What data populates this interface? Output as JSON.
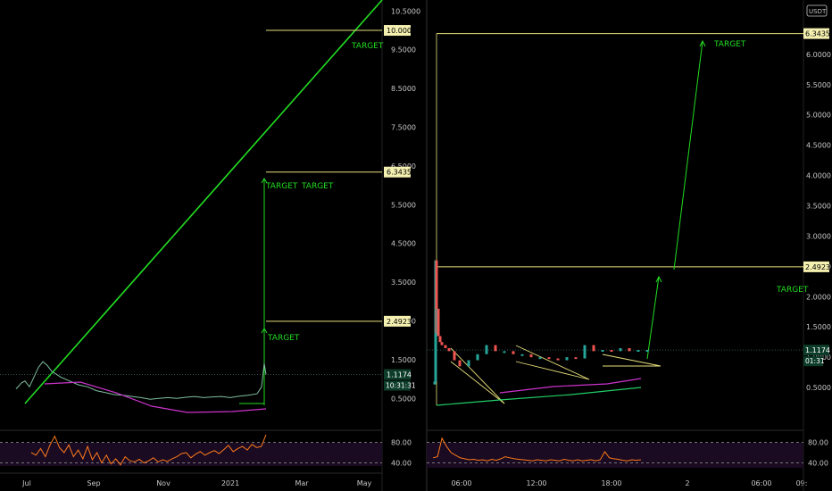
{
  "colors": {
    "background": "#000000",
    "axis_text": "#c8c8c8",
    "grid": "#1f1f1f",
    "target": "#22dd22",
    "level_line": "#e8e07a",
    "price_tag_bg": "#f4f0b0",
    "current_tag_bg": "#0d3d2a",
    "current_tag_text": "#ffffff",
    "up_candle": "#26a69a",
    "down_candle": "#ef5350",
    "ma_magenta": "#cc33cc",
    "ma_green": "#22cc66",
    "rsi_line": "#ff7a1a",
    "rsi_band": "#1a0a22"
  },
  "chart_data": [
    {
      "type": "line",
      "panel": "left-daily",
      "x_tick_labels": [
        "Jul",
        "Sep",
        "Nov",
        "2021",
        "Mar",
        "May"
      ],
      "y_tick_labels": [
        "10.5000",
        "9.5000",
        "8.5000",
        "7.5000",
        "6.5000",
        "5.5000",
        "4.5000",
        "3.5000",
        "2.5000",
        "1.5000",
        "0.5000"
      ],
      "y_ticks": [
        10.5,
        9.5,
        8.5,
        7.5,
        6.5,
        5.5,
        4.5,
        3.5,
        2.5,
        1.5,
        0.5
      ],
      "ylim": [
        0.0,
        10.6
      ],
      "price_tags": [
        {
          "label": "10.0000",
          "value": 10.0
        },
        {
          "label": "6.3435",
          "value": 6.3435
        },
        {
          "label": "2.4923",
          "value": 2.4923
        }
      ],
      "current_price": {
        "label": "1.1174",
        "value": 1.1174,
        "countdown": "10:31:31"
      },
      "annotations": [
        {
          "text": "TARGET",
          "value": 9.8
        },
        {
          "text": "TARGET",
          "value": 6.15
        },
        {
          "text": "TARGET",
          "value": 6.15
        },
        {
          "text": "TARGET",
          "value": 2.25
        }
      ],
      "price_series": {
        "x": [
          0,
          3,
          6,
          10,
          15,
          20,
          25,
          30,
          35,
          40,
          50,
          60,
          70,
          80,
          90,
          100,
          110,
          120,
          130,
          140,
          150,
          160,
          170,
          180,
          190,
          200,
          210,
          220,
          230,
          240,
          250,
          260,
          270,
          275,
          278,
          280
        ],
        "y": [
          0.75,
          0.82,
          0.9,
          0.95,
          0.8,
          1.05,
          1.3,
          1.45,
          1.35,
          1.2,
          1.05,
          0.95,
          0.85,
          0.8,
          0.7,
          0.65,
          0.6,
          0.58,
          0.55,
          0.52,
          0.48,
          0.5,
          0.52,
          0.5,
          0.53,
          0.55,
          0.52,
          0.54,
          0.55,
          0.52,
          0.56,
          0.58,
          0.62,
          0.8,
          1.4,
          1.12
        ]
      },
      "rsi": {
        "y_tick_labels": [
          "80.00",
          "40.00"
        ],
        "y_ticks": [
          80,
          40
        ],
        "ylim": [
          20,
          100
        ],
        "values": [
          60,
          55,
          68,
          52,
          75,
          92,
          70,
          60,
          75,
          52,
          65,
          48,
          72,
          46,
          60,
          40,
          55,
          38,
          48,
          36,
          52,
          44,
          42,
          47,
          40,
          44,
          50,
          42,
          46,
          43,
          48,
          52,
          58,
          60,
          50,
          57,
          62,
          55,
          60,
          64,
          58,
          66,
          74,
          62,
          68,
          72,
          65,
          76,
          70,
          72,
          95
        ]
      }
    },
    {
      "type": "line",
      "panel": "right-intraday",
      "currency_badge": "USDT",
      "x_tick_labels": [
        "06:00",
        "12:00",
        "18:00",
        "2",
        "06:00",
        "09:"
      ],
      "y_tick_labels": [
        "6.0000",
        "5.5000",
        "5.0000",
        "4.5000",
        "4.0000",
        "3.5000",
        "3.0000",
        "2.5000",
        "2.0000",
        "1.5000",
        "1.0000",
        "0.5000"
      ],
      "y_ticks": [
        6.0,
        5.5,
        5.0,
        4.5,
        4.0,
        3.5,
        3.0,
        2.5,
        2.0,
        1.5,
        1.0,
        0.5
      ],
      "ylim": [
        0.0,
        6.75
      ],
      "price_tags": [
        {
          "label": "6.3435",
          "value": 6.3435
        },
        {
          "label": "2.4923",
          "value": 2.4923
        }
      ],
      "current_price": {
        "label": "1.1174",
        "value": 1.1174,
        "countdown": "01:31"
      },
      "annotations": [
        {
          "text": "TARGET",
          "value": 6.3
        },
        {
          "text": "TARGET",
          "value": 2.25
        }
      ],
      "price_series": {
        "x": [
          0,
          2,
          3,
          4,
          5,
          6,
          8,
          10,
          14,
          18,
          24,
          30,
          40,
          50,
          60,
          70,
          80,
          90,
          100,
          110,
          120,
          130,
          140,
          150,
          160,
          170,
          180,
          190,
          200,
          210,
          220,
          230,
          240
        ],
        "y": [
          0.55,
          0.6,
          2.6,
          1.4,
          1.8,
          1.35,
          1.25,
          1.2,
          1.15,
          1.1,
          0.95,
          0.85,
          0.95,
          1.05,
          1.2,
          1.1,
          1.1,
          1.05,
          1.05,
          1.0,
          1.0,
          0.98,
          0.95,
          1.0,
          0.98,
          1.2,
          1.1,
          1.12,
          1.1,
          1.15,
          1.1,
          1.12,
          1.12
        ]
      },
      "rsi": {
        "y_tick_labels": [
          "80.00",
          "40.00"
        ],
        "y_ticks": [
          80,
          40
        ],
        "ylim": [
          20,
          100
        ],
        "values": [
          50,
          52,
          88,
          72,
          60,
          55,
          50,
          48,
          46,
          47,
          45,
          46,
          44,
          47,
          45,
          48,
          52,
          50,
          48,
          47,
          46,
          45,
          44,
          46,
          45,
          44,
          46,
          45,
          44,
          47,
          45,
          44,
          46,
          44,
          45,
          46,
          44,
          46,
          62,
          50,
          48,
          47,
          45,
          44,
          46,
          45,
          46
        ]
      }
    }
  ]
}
